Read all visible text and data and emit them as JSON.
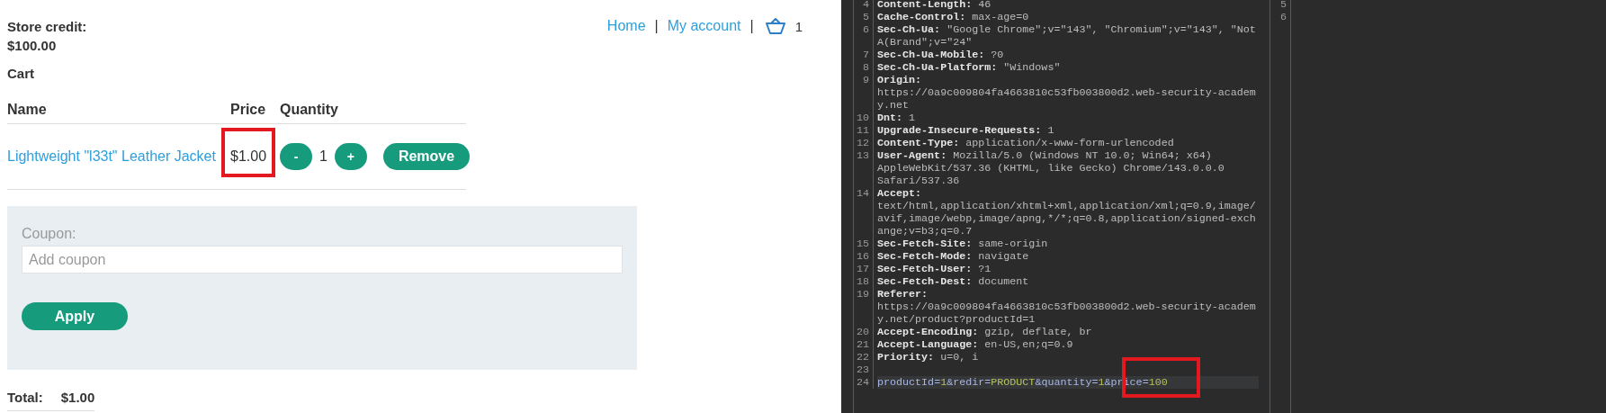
{
  "store": {
    "credit_label": "Store credit:",
    "credit_value": "$100.00",
    "nav": [
      {
        "label": "Home",
        "separator": "|"
      },
      {
        "label": "My account",
        "separator": "|"
      }
    ],
    "cart_count": "1",
    "cart_title": "Cart",
    "columns": [
      "Name",
      "Price",
      "Quantity"
    ],
    "items": [
      {
        "name": "Lightweight \"l33t\" Leather Jacket",
        "price": "$1.00",
        "price_highlighted": true,
        "decrement": "-",
        "quantity": "1",
        "increment": "+",
        "remove": "Remove"
      }
    ],
    "coupon": {
      "label": "Coupon:",
      "placeholder": "Add coupon",
      "button": "Apply"
    },
    "total_label": "Total:",
    "total_value": "$1.00"
  },
  "request_editor": {
    "lines": [
      {
        "number": "4",
        "kind": "header",
        "name": "Content-Length:",
        "value": " 46"
      },
      {
        "number": "5",
        "kind": "header",
        "name": "Cache-Control:",
        "value": " max-age=0"
      },
      {
        "number": "6",
        "kind": "header",
        "name": "Sec-Ch-Ua:",
        "value": " \"Google Chrome\";v=\"143\", \"Chromium\";v=\"143\", \"Not A(Brand\";v=\"24\""
      },
      {
        "number": "7",
        "kind": "header",
        "name": "Sec-Ch-Ua-Mobile:",
        "value": " ?0"
      },
      {
        "number": "8",
        "kind": "header",
        "name": "Sec-Ch-Ua-Platform:",
        "value": " \"Windows\""
      },
      {
        "number": "9",
        "kind": "header",
        "name": "Origin:",
        "value": " https://0a9c009804fa4663810c53fb003800d2.web-security-academy.net"
      },
      {
        "number": "10",
        "kind": "header",
        "name": "Dnt:",
        "value": " 1"
      },
      {
        "number": "11",
        "kind": "header",
        "name": "Upgrade-Insecure-Requests:",
        "value": " 1"
      },
      {
        "number": "12",
        "kind": "header",
        "name": "Content-Type:",
        "value": " application/x-www-form-urlencoded"
      },
      {
        "number": "13",
        "kind": "header",
        "name": "User-Agent:",
        "value": " Mozilla/5.0 (Windows NT 10.0; Win64; x64) AppleWebKit/537.36 (KHTML, like Gecko) Chrome/143.0.0.0 Safari/537.36"
      },
      {
        "number": "14",
        "kind": "header",
        "name": "Accept:",
        "value": " text/html,application/xhtml+xml,application/xml;q=0.9,image/avif,image/webp,image/apng,*/*;q=0.8,application/signed-exchange;v=b3;q=0.7"
      },
      {
        "number": "15",
        "kind": "header",
        "name": "Sec-Fetch-Site:",
        "value": " same-origin"
      },
      {
        "number": "16",
        "kind": "header",
        "name": "Sec-Fetch-Mode:",
        "value": " navigate"
      },
      {
        "number": "17",
        "kind": "header",
        "name": "Sec-Fetch-User:",
        "value": " ?1"
      },
      {
        "number": "18",
        "kind": "header",
        "name": "Sec-Fetch-Dest:",
        "value": " document"
      },
      {
        "number": "19",
        "kind": "header",
        "name": "Referer:",
        "value": " https://0a9c009804fa4663810c53fb003800d2.web-security-academy.net/product?productId=1"
      },
      {
        "number": "20",
        "kind": "header",
        "name": "Accept-Encoding:",
        "value": " gzip, deflate, br"
      },
      {
        "number": "21",
        "kind": "header",
        "name": "Accept-Language:",
        "value": " en-US,en;q=0.9"
      },
      {
        "number": "22",
        "kind": "header",
        "name": "Priority:",
        "value": " u=0, i"
      },
      {
        "number": "23",
        "kind": "blank"
      },
      {
        "number": "24",
        "kind": "body",
        "selected": true,
        "highlighted": true,
        "parts": [
          {
            "text": "productId",
            "kind": "name"
          },
          {
            "text": "=",
            "kind": "punct"
          },
          {
            "text": "1",
            "kind": "value"
          },
          {
            "text": "&",
            "kind": "punct"
          },
          {
            "text": "redir",
            "kind": "name"
          },
          {
            "text": "=",
            "kind": "punct"
          },
          {
            "text": "PRODUCT",
            "kind": "value"
          },
          {
            "text": "&",
            "kind": "punct"
          },
          {
            "text": "quantity",
            "kind": "name"
          },
          {
            "text": "=",
            "kind": "punct"
          },
          {
            "text": "1",
            "kind": "value"
          },
          {
            "text": "&",
            "kind": "punct"
          },
          {
            "text": "price",
            "kind": "name"
          },
          {
            "text": "=",
            "kind": "punct"
          },
          {
            "text": "100",
            "kind": "value"
          }
        ]
      }
    ]
  },
  "response_editor": {
    "line_numbers": [
      "5",
      "6"
    ]
  }
}
